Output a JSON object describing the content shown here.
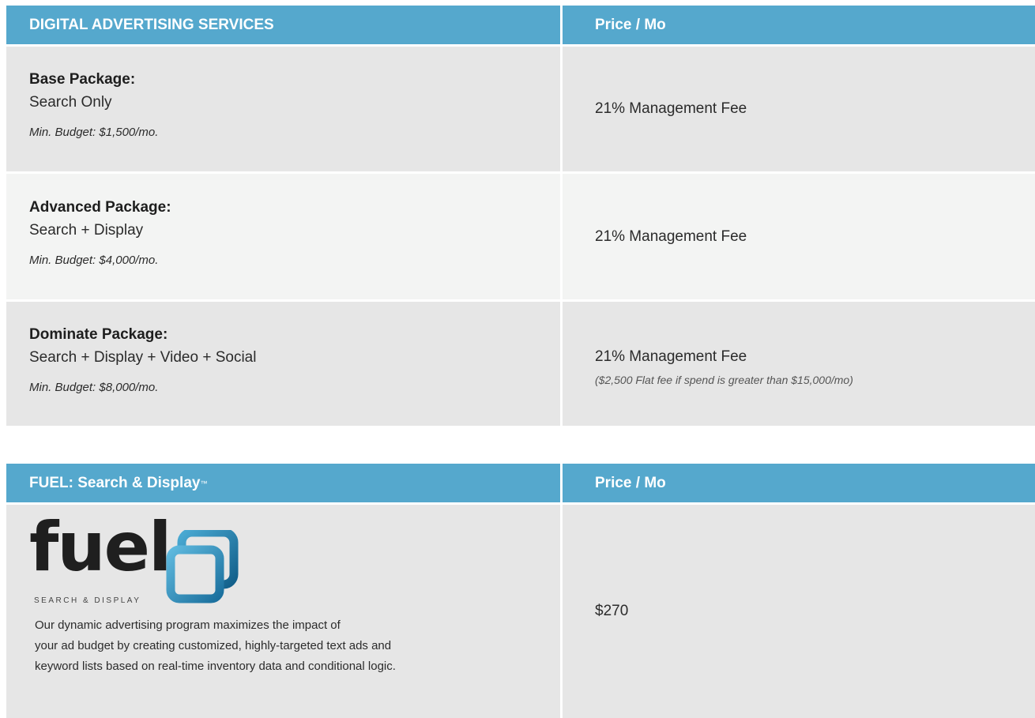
{
  "table1": {
    "header_service": "DIGITAL ADVERTISING SERVICES",
    "header_price": "Price / Mo",
    "rows": [
      {
        "title": "Base Package:",
        "subtitle": "Search Only",
        "min_budget": "Min. Budget: $1,500/mo.",
        "fee": "21% Management Fee",
        "note": ""
      },
      {
        "title": "Advanced Package:",
        "subtitle": "Search + Display",
        "min_budget": "Min. Budget: $4,000/mo.",
        "fee": "21% Management Fee",
        "note": ""
      },
      {
        "title": "Dominate Package:",
        "subtitle": "Search + Display + Video + Social",
        "min_budget": "Min. Budget: $8,000/mo.",
        "fee": "21% Management Fee",
        "note": "($2,500 Flat fee if spend is greater than $15,000/mo)"
      }
    ]
  },
  "table2": {
    "header_service": "FUEL: Search & Display",
    "header_tm": "™",
    "header_price": "Price / Mo",
    "logo_word": "fuel",
    "logo_sub": "SEARCH & DISPLAY",
    "logo_colors": {
      "outer": "#1d7fae",
      "inner": "#3a9fcb"
    },
    "description_lines": [
      "Our dynamic advertising program maximizes the impact of",
      "your ad budget  by creating customized, highly-targeted text ads and",
      "keyword lists based on real-time inventory data and conditional logic."
    ],
    "price": "$270"
  }
}
